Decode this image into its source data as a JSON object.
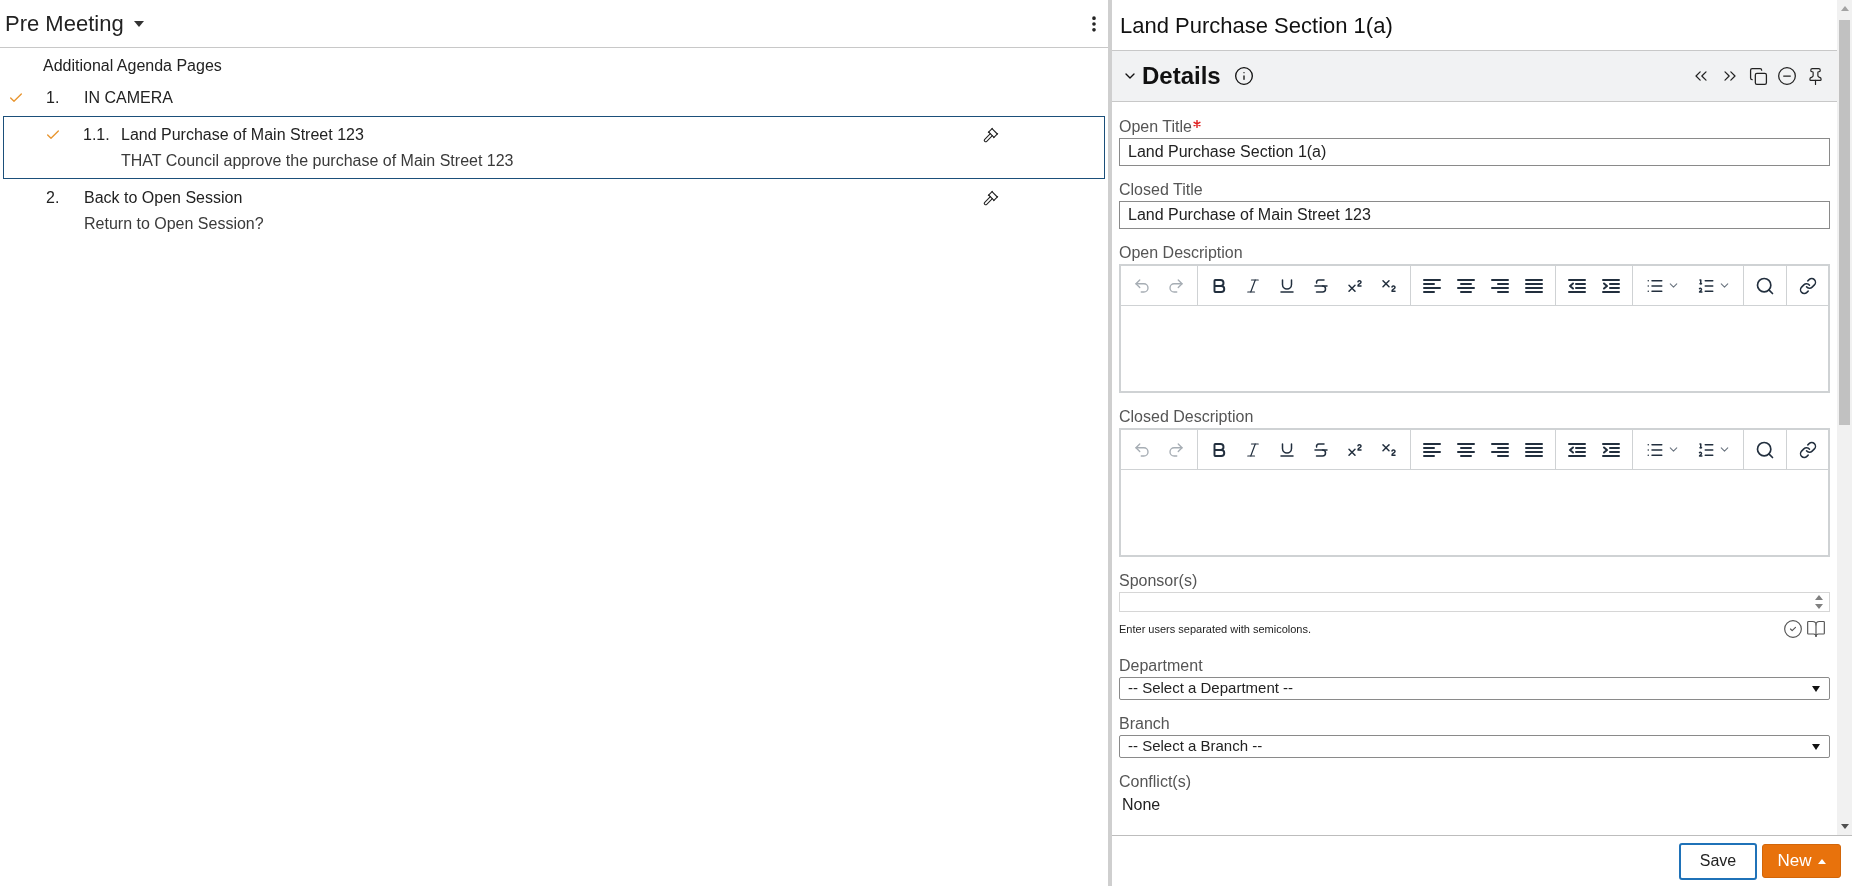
{
  "agenda_panel": {
    "title": "Pre Meeting",
    "section_label": "Additional Agenda Pages",
    "items": [
      {
        "number": "1.",
        "title": "IN CAMERA",
        "checked": true,
        "selected": false,
        "motion": false,
        "children": [
          {
            "number": "1.1.",
            "title": "Land Purchase of Main Street 123",
            "description": "THAT Council approve the purchase of Main Street 123",
            "checked": true,
            "selected": true,
            "motion": true
          }
        ]
      },
      {
        "number": "2.",
        "title": "Back to Open Session",
        "description": "Return to Open Session?",
        "checked": false,
        "selected": false,
        "motion": true
      }
    ]
  },
  "detail_panel": {
    "title": "Land Purchase Section 1(a)",
    "section": {
      "title": "Details",
      "expanded": true
    },
    "fields": [
      {
        "kind": "text",
        "label": "Open Title",
        "required": true,
        "value": "Land Purchase Section 1(a)"
      },
      {
        "kind": "text",
        "label": "Closed Title",
        "required": false,
        "value": "Land Purchase of Main Street 123"
      },
      {
        "kind": "richtext",
        "label": "Open Description",
        "required": false,
        "can_undo": false,
        "can_redo": false
      },
      {
        "kind": "richtext",
        "label": "Closed Description",
        "required": false,
        "can_undo": false,
        "can_redo": false
      },
      {
        "kind": "people",
        "label": "Sponsor(s)",
        "required": false,
        "help": "Enter users separated with semicolons."
      },
      {
        "kind": "select",
        "label": "Department",
        "required": false,
        "value": "-- Select a Department --"
      },
      {
        "kind": "select",
        "label": "Branch",
        "required": false,
        "value": "-- Select a Branch --"
      },
      {
        "kind": "static",
        "label": "Conflict(s)",
        "required": false,
        "value": "None"
      }
    ]
  },
  "footer": {
    "buttons": [
      {
        "label": "Save",
        "kind": "secondary",
        "menu": false
      },
      {
        "label": "New",
        "kind": "primary",
        "menu": true
      }
    ]
  }
}
